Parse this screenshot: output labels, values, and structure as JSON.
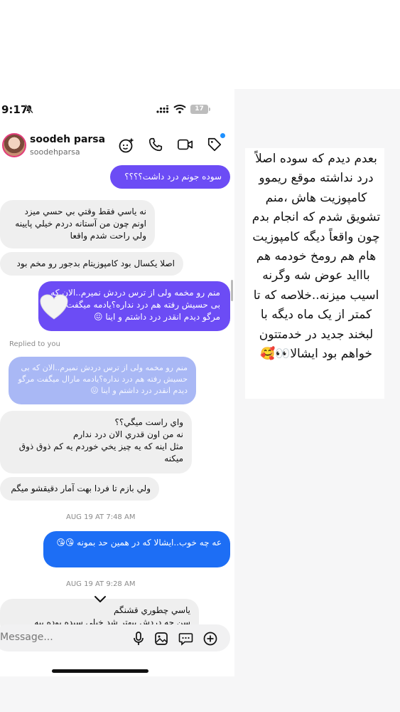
{
  "status_bar": {
    "time": "9:17",
    "battery": "17"
  },
  "contact": {
    "name": "soodeh parsa",
    "handle": "soodehparsa"
  },
  "messages": {
    "m1": "سوده جونم درد داشت؟؟؟؟",
    "m2": "نه یاسي فقط وقتي بي حسي ميزد اونم چون من آستانه دردم خيلي پايينه ولي راحت شدم واقعا",
    "m3": "اصلا يكسال بود كامپوزيتام بدجور رو مخم بود",
    "m4": "منم رو مخمه ولی از ترس دردش نمیرم..الان که بی حسیش رفته هم درد نداره؟یادمه میگفت مرگو دیدم انقدر درد داشتم و اینا 😖",
    "replied_label": "Replied to you",
    "m5": "منم رو مخمه ولی از ترس دردش نمیرم..الان که بی حسیش رفته هم درد نداره؟یادمه مارال میگفت مرگو دیدم انقدر درد داشتم و اینا 😖",
    "m6_line1": "واي راست ميگي؟؟",
    "m6_line2": "نه من اون قدري الان درد ندارم",
    "m6_line3": "مثل اينه كه يه چيز يخي خوردم يه كم ذوق ذوق ميكنه",
    "m7": "ولي بازم تا فردا بهت آمار دقيقشو ميگم",
    "ts1": "AUG 19 AT 7:48 AM",
    "m8": "عه چه خوب..ایشالا که در همین حد بمونه 😘😘",
    "ts2": "AUG 19 AT 9:28 AM",
    "m9_line1": "ياسي  چطوري قشنگم",
    "m9_line2": "سن چه دردش بيهتر شد خيلي سيده بوده بيه"
  },
  "composer": {
    "placeholder": "Message..."
  },
  "story": {
    "text": "بعدم دیدم که سوده اصلاً درد نداشته موقع ریموو کامپوزیت هاش ،منم تشویق شدم که انجام بدم چون واقعاً دیگه کامپوزیت هام هم رومخ خودمه هم باااید عوض شه وگرنه اسیب میزنه..خلاصه که تا کمتر از یک ماه دیگه با لبخند جدید در خدمتتون خواهم بود ایشالا👀🥰"
  },
  "colors": {
    "outgoing": "#6c4cf5",
    "outgoing_blue": "#1d6ef5",
    "incoming": "#efefef",
    "reply": "#a9b8f5"
  },
  "icons": [
    "mute-icon",
    "signal-icon",
    "wifi-icon",
    "ai-sticker-icon",
    "phone-icon",
    "video-icon",
    "tag-icon",
    "chevron-down-icon",
    "microphone-icon",
    "gallery-icon",
    "sticker-icon",
    "plus-icon",
    "heart-reaction-icon"
  ]
}
